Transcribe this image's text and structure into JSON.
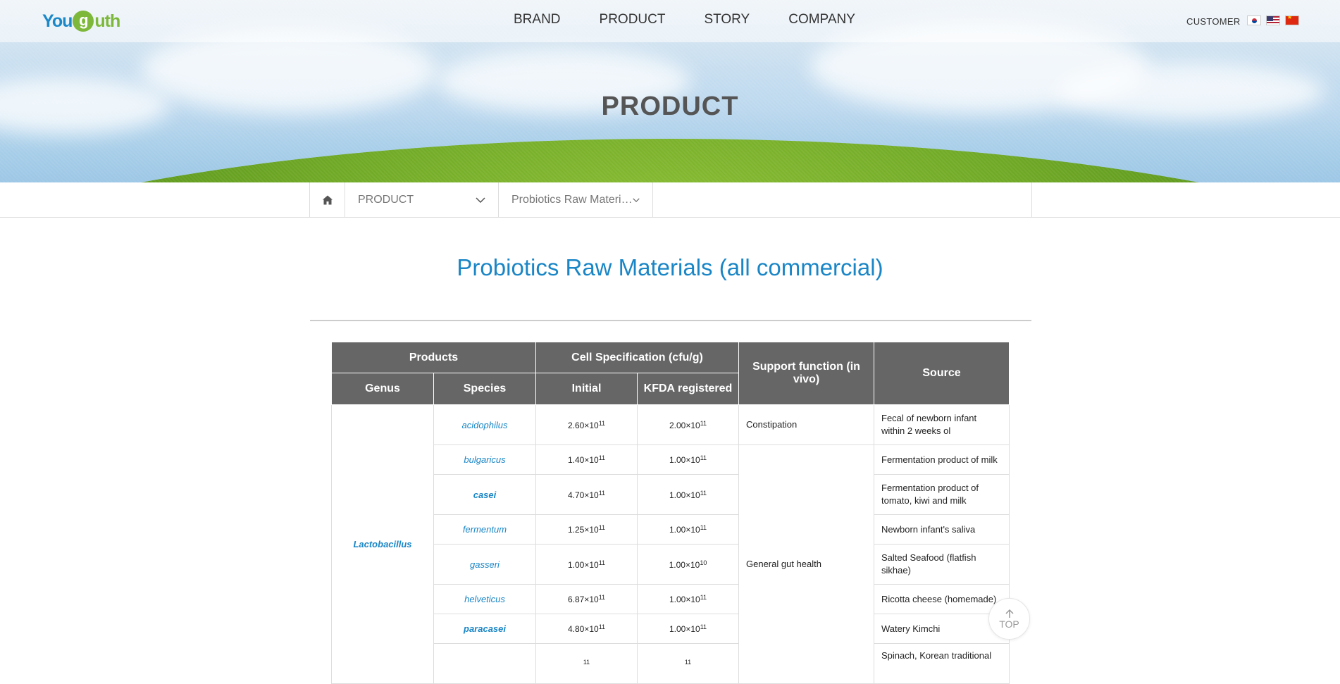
{
  "header": {
    "logo": {
      "you": "You",
      "g": "g",
      "uth": "uth"
    },
    "nav": [
      "BRAND",
      "PRODUCT",
      "STORY",
      "COMPANY"
    ],
    "customer": "CUSTOMER",
    "flags": [
      "kr-flag-icon",
      "us-flag-icon",
      "cn-flag-icon"
    ]
  },
  "hero": {
    "title": "PRODUCT"
  },
  "breadcrumb": {
    "home_icon": "home-icon",
    "level1": "PRODUCT",
    "level2": "Probiotics Raw Materials (all commercial)"
  },
  "page_title": "Probiotics Raw Materials (all commercial)",
  "table": {
    "headers": {
      "products": "Products",
      "cell_spec": "Cell Specification (cfu/g)",
      "support": "Support function (in vivo)",
      "source": "Source",
      "genus": "Genus",
      "species": "Species",
      "initial": "Initial",
      "kfda": "KFDA registered"
    },
    "genus": "Lactobacillus",
    "rows": [
      {
        "species": "acidophilus",
        "initial_m": "2.60",
        "initial_e": "11",
        "kfda_m": "2.00",
        "kfda_e": "11",
        "func": "Constipation",
        "source": "Fecal of newborn infant within 2 weeks ol"
      },
      {
        "species": "bulgaricus",
        "initial_m": "1.40",
        "initial_e": "11",
        "kfda_m": "1.00",
        "kfda_e": "11",
        "func": "General gut health",
        "source": "Fermentation product of milk"
      },
      {
        "species": "casei",
        "initial_m": "4.70",
        "initial_e": "11",
        "kfda_m": "1.00",
        "kfda_e": "11",
        "source": "Fermentation product of tomato, kiwi and milk"
      },
      {
        "species": "fermentum",
        "initial_m": "1.25",
        "initial_e": "11",
        "kfda_m": "1.00",
        "kfda_e": "11",
        "source": "Newborn infant's saliva"
      },
      {
        "species": "gasseri",
        "initial_m": "1.00",
        "initial_e": "11",
        "kfda_m": "1.00",
        "kfda_e": "10",
        "source": "Salted Seafood (flatfish sikhae)"
      },
      {
        "species": "helveticus",
        "initial_m": "6.87",
        "initial_e": "11",
        "kfda_m": "1.00",
        "kfda_e": "11",
        "source": "Ricotta cheese (homemade)"
      },
      {
        "species": "paracasei",
        "initial_m": "4.80",
        "initial_e": "11",
        "kfda_m": "1.00",
        "kfda_e": "11",
        "source": "Watery Kimchi"
      },
      {
        "species": "",
        "initial_m": "",
        "initial_e": "11",
        "kfda_m": "",
        "kfda_e": "11",
        "source": "Spinach, Korean traditional"
      }
    ],
    "times10": "×10"
  },
  "top_button": {
    "label": "TOP",
    "icon": "arrow-up-icon"
  }
}
